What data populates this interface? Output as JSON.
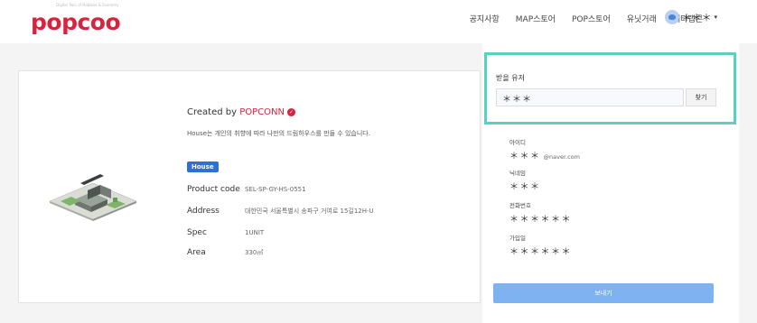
{
  "header": {
    "logo": "popcoo",
    "logo_tagline": "Digital Twin of Hobbies & Economy",
    "nav": [
      "공지사항",
      "MAP스토어",
      "POP스토어",
      "유닛거래",
      "메타랩콘"
    ],
    "user_name": "＊＊＊"
  },
  "product": {
    "created_by_prefix": "Created by ",
    "created_by_brand": "POPCONN",
    "description": "House는 개인의 취향에 따라 나만의 드림하우스를 만들 수 있습니다.",
    "badge": "House",
    "rows": [
      {
        "label": "Product code",
        "value": "SEL-SP-GY-HS-0551"
      },
      {
        "label": "Address",
        "value": "대한민국 서울특별시 송파구 거여로 15길12H-U"
      },
      {
        "label": "Spec",
        "value": "1UNIT"
      },
      {
        "label": "Area",
        "value": "330㎡"
      }
    ]
  },
  "recipient": {
    "label": "받을 유저",
    "search_value": "＊＊＊",
    "search_button": "찾기"
  },
  "user_info": {
    "id_label": "아이디",
    "id_value": "＊＊＊",
    "id_suffix": "@naver.com",
    "nickname_label": "닉네임",
    "nickname_value": "＊＊＊",
    "phone_label": "전화번호",
    "phone_value": "＊＊＊＊＊＊",
    "joined_label": "가입일",
    "joined_value": "＊＊＊＊＊＊"
  },
  "send_button": "보내기",
  "colors": {
    "brand": "#d6243f",
    "highlight": "#5ad0c0",
    "badge": "#2f6fd6",
    "send": "#7fb2f1"
  }
}
